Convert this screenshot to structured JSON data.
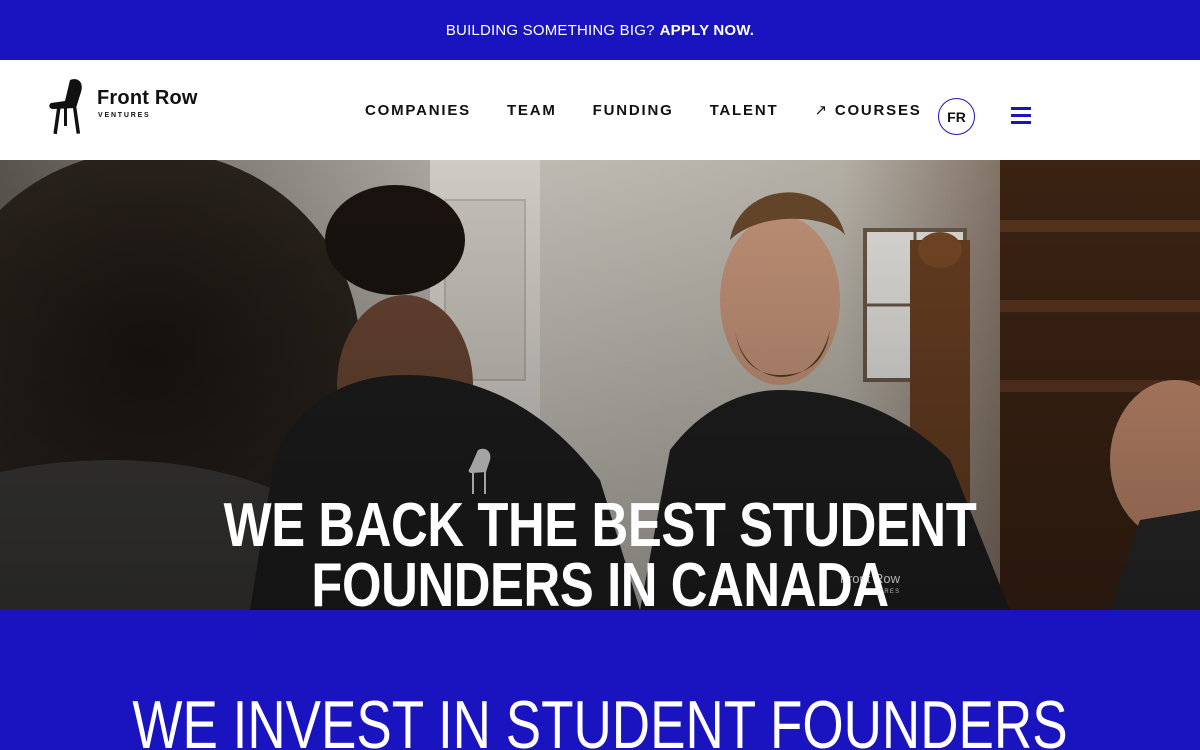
{
  "banner": {
    "lead": "BUILDING SOMETHING BIG?",
    "cta": "APPLY NOW."
  },
  "logo": {
    "brand": "Front Row",
    "sub": "VENTURES",
    "icon": "chair-icon"
  },
  "nav": {
    "items": [
      "COMPANIES",
      "TEAM",
      "FUNDING",
      "TALENT",
      "COURSES"
    ],
    "courses_arrow": "↗",
    "lang": "FR",
    "menu_icon": "hamburger-menu-icon"
  },
  "hero": {
    "title_line1": "WE BACK THE BEST STUDENT",
    "title_line2": "FOUNDERS IN CANADA",
    "shirt_brand": "Front Row",
    "shirt_sub": "VENTURES"
  },
  "section": {
    "heading": "WE INVEST IN STUDENT FOUNDERS"
  },
  "colors": {
    "brand_blue": "#1a14c0",
    "text_dark": "#111111",
    "white": "#ffffff"
  }
}
